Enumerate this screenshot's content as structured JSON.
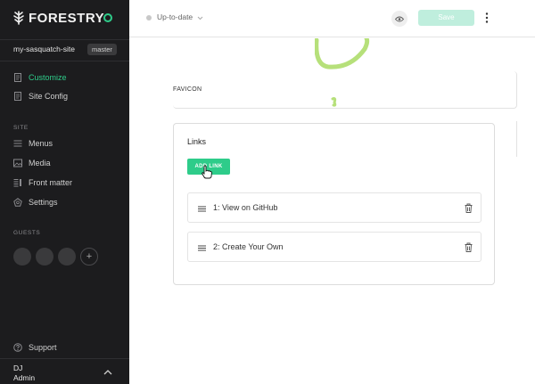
{
  "app": {
    "brand": "FORESTRY",
    "site_name": "my-sasquatch-site",
    "branch": "master"
  },
  "sidebar": {
    "primary_items": [
      {
        "label": "Customize",
        "icon": "document-icon",
        "active": true
      },
      {
        "label": "Site Config",
        "icon": "document-icon",
        "active": false
      }
    ],
    "site_section_label": "SITE",
    "site_items": [
      {
        "label": "Menus",
        "icon": "menu-icon"
      },
      {
        "label": "Media",
        "icon": "image-icon"
      },
      {
        "label": "Front matter",
        "icon": "front-matter-icon"
      },
      {
        "label": "Settings",
        "icon": "settings-icon"
      }
    ],
    "guests_label": "GUESTS",
    "guest_add": "+",
    "support_label": "Support",
    "user": {
      "initials": "DJ",
      "role": "Admin"
    }
  },
  "topbar": {
    "status_text": "Up-to-date",
    "save_label": "Save"
  },
  "main": {
    "favicon_label": "FAVICON",
    "links_title": "Links",
    "add_link_label": "ADD LINK",
    "links": [
      {
        "label": "1: View on GitHub"
      },
      {
        "label": "2: Create Your Own"
      }
    ]
  },
  "colors": {
    "accent": "#2ecc8a",
    "sidebar_bg": "#1c1c1e",
    "save_disabled": "#bfeedd",
    "scribble": "#b6e07a"
  }
}
